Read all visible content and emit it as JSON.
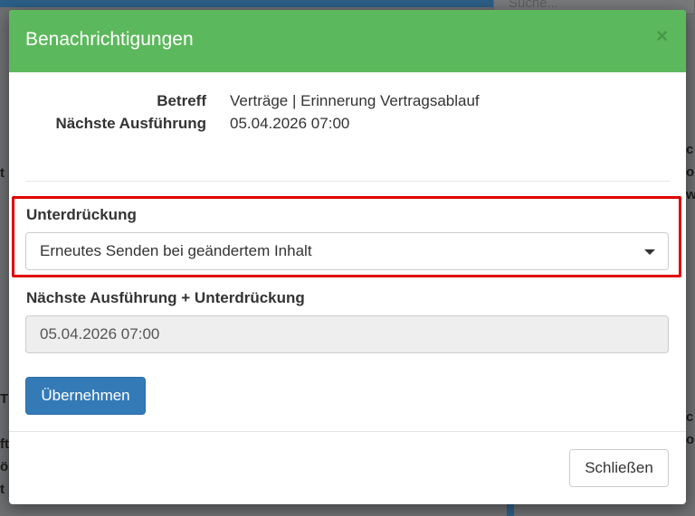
{
  "background": {
    "search_placeholder": "Suche..."
  },
  "modal": {
    "title": "Benachrichtigungen",
    "close_symbol": "×",
    "info": [
      {
        "label": "Betreff",
        "value": "Verträge | Erinnerung Vertragsablauf"
      },
      {
        "label": "Nächste Ausführung",
        "value": "05.04.2026 07:00"
      }
    ],
    "suppression": {
      "label": "Unterdrückung",
      "selected": "Erneutes Senden bei geändertem Inhalt"
    },
    "next_with_suppression": {
      "label": "Nächste Ausführung + Unterdrückung",
      "value": "05.04.2026 07:00"
    },
    "apply_button": "Übernehmen",
    "close_button": "Schließen"
  },
  "colors": {
    "header": "#5cb85c",
    "primary": "#337ab7",
    "highlight": "#e00000"
  }
}
